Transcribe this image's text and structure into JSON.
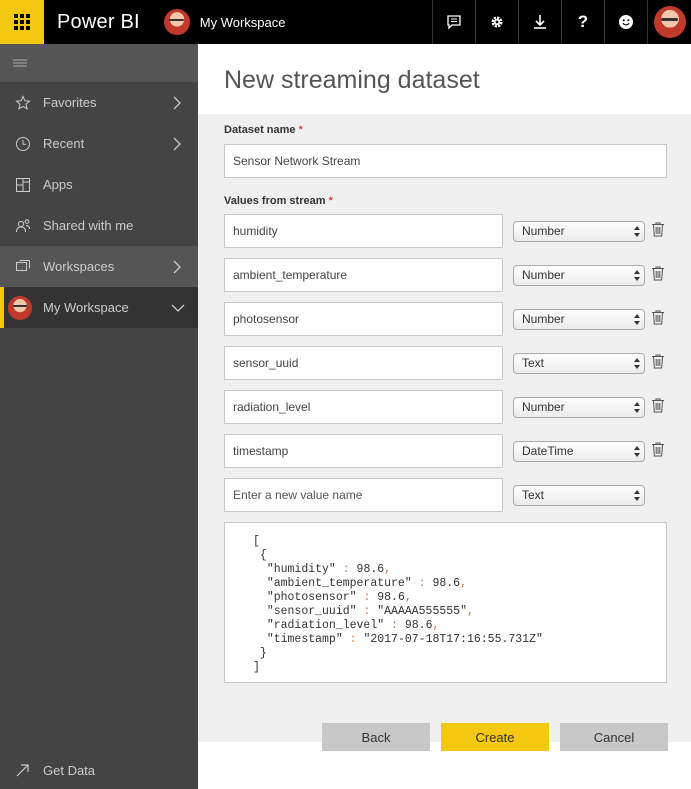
{
  "app": {
    "title": "Power BI",
    "workspace": "My Workspace"
  },
  "topbar": {
    "icons": [
      "feedback-icon",
      "gear-icon",
      "download-icon",
      "help-icon",
      "smiley-icon"
    ],
    "help_glyph": "?"
  },
  "sidebar": {
    "items": [
      {
        "label": "Favorites",
        "icon": "star-icon",
        "chevron": true
      },
      {
        "label": "Recent",
        "icon": "clock-icon",
        "chevron": true
      },
      {
        "label": "Apps",
        "icon": "apps-icon",
        "chevron": false
      },
      {
        "label": "Shared with me",
        "icon": "shared-icon",
        "chevron": false
      },
      {
        "label": "Workspaces",
        "icon": "workspaces-icon",
        "chevron": true
      },
      {
        "label": "My Workspace",
        "icon": "avatar",
        "chevron": true
      }
    ],
    "get_data": "Get Data"
  },
  "page": {
    "title": "New streaming dataset",
    "dataset_name_label": "Dataset name",
    "dataset_name_value": "Sensor Network Stream",
    "values_label": "Values from stream",
    "required_mark": "*",
    "fields": [
      {
        "name": "humidity",
        "type": "Number"
      },
      {
        "name": "ambient_temperature",
        "type": "Number"
      },
      {
        "name": "photosensor",
        "type": "Number"
      },
      {
        "name": "sensor_uuid",
        "type": "Text"
      },
      {
        "name": "radiation_level",
        "type": "Number"
      },
      {
        "name": "timestamp",
        "type": "DateTime"
      }
    ],
    "new_field_placeholder": "Enter a new value name",
    "new_field_type": "Text",
    "json_preview": {
      "open_bracket": "[",
      "open_brace": "{",
      "lines": [
        {
          "key": "\"humidity\"",
          "value": "98.6"
        },
        {
          "key": "\"ambient_temperature\"",
          "value": "98.6"
        },
        {
          "key": "\"photosensor\"",
          "value": "98.6"
        },
        {
          "key": "\"sensor_uuid\"",
          "value": "\"AAAAA555555\""
        },
        {
          "key": "\"radiation_level\"",
          "value": "98.6"
        },
        {
          "key": "\"timestamp\"",
          "value": "\"2017-07-18T17:16:55.731Z\""
        }
      ],
      "close_brace": "}",
      "close_bracket": "]"
    }
  },
  "buttons": {
    "back": "Back",
    "create": "Create",
    "cancel": "Cancel"
  },
  "colors": {
    "accent": "#f2c811",
    "topbar": "#000000",
    "sidebar": "#444444"
  }
}
